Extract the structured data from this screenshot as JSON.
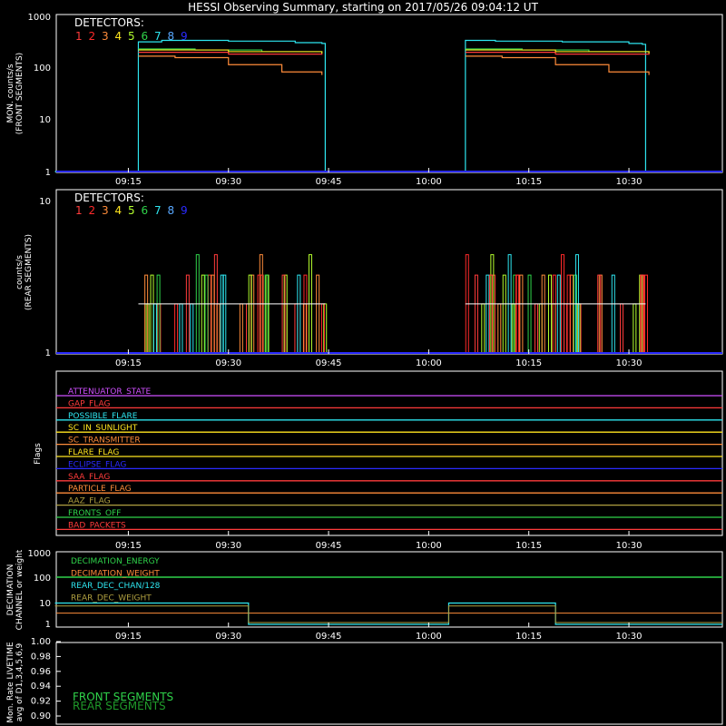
{
  "title": "HESSI Observing Summary, starting on 2017/05/26 09:04:12 UT",
  "x_tick_labels": [
    "09:15",
    "09:30",
    "09:45",
    "10:00",
    "10:15",
    "10:30"
  ],
  "detectors": {
    "label": "DETECTORS:",
    "numbers": [
      "1",
      "2",
      "3",
      "4",
      "5",
      "6",
      "7",
      "8",
      "9"
    ],
    "colors": [
      "#ff3b3b",
      "#ff2a2a",
      "#ff8c3a",
      "#ffe51f",
      "#b4ff2e",
      "#2fd34a",
      "#2ee6f0",
      "#58a8ff",
      "#2a2aff"
    ]
  },
  "chart_data": [
    {
      "type": "line",
      "panel": "front",
      "ylabel": [
        "MON. counts/s",
        "(FRONT SEGMENTS)"
      ],
      "yscale": "log",
      "ylim": [
        1,
        1000
      ],
      "y_tick_labels": [
        "1",
        "10",
        "100",
        "1000"
      ],
      "xrange": [
        "09:04:12",
        "10:44"
      ],
      "series": [
        {
          "color": "#2ee6f0",
          "x": [
            "09:04",
            "09:16",
            "09:16.5",
            "09:20",
            "09:30",
            "09:40",
            "09:44",
            "09:44.5",
            "10:05",
            "10:05.5",
            "10:10",
            "10:20",
            "10:30",
            "10:32",
            "10:32.5",
            "10:44"
          ],
          "y": [
            1,
            1,
            300,
            320,
            310,
            290,
            280,
            1,
            1,
            320,
            310,
            300,
            280,
            270,
            1,
            1
          ]
        },
        {
          "color": "#2fd34a",
          "x": [
            "09:16.5",
            "09:25",
            "09:35",
            "09:44"
          ],
          "y": [
            220,
            210,
            195,
            185
          ]
        },
        {
          "color": "#ff8c3a",
          "x": [
            "09:16.5",
            "09:22",
            "09:30",
            "09:38",
            "09:44"
          ],
          "y": [
            160,
            150,
            110,
            80,
            70
          ]
        },
        {
          "color": "#ff3b3b",
          "x": [
            "09:16.5",
            "09:30",
            "09:44"
          ],
          "y": [
            190,
            175,
            170
          ]
        },
        {
          "color": "#ffe51f",
          "x": [
            "09:16.5",
            "09:30",
            "09:44"
          ],
          "y": [
            210,
            195,
            180
          ]
        }
      ]
    },
    {
      "type": "line",
      "panel": "rear",
      "ylabel": [
        "counts/s",
        "(REAR SEGMENTS)"
      ],
      "yscale": "log",
      "ylim": [
        1,
        10
      ],
      "y_tick_labels": [
        "1",
        "10"
      ],
      "values_note": "",
      "levels": [
        1,
        2,
        3,
        4
      ]
    },
    {
      "type": "line",
      "panel": "flags",
      "ylabel": "Flags",
      "flags": [
        {
          "name": "ATTENUATOR_STATE",
          "color": "#d050ff"
        },
        {
          "name": "GAP_FLAG",
          "color": "#ff3b3b"
        },
        {
          "name": "POSSIBLE_FLARE",
          "color": "#2ee6f0"
        },
        {
          "name": "SC_IN_SUNLIGHT",
          "color": "#ffe51f"
        },
        {
          "name": "SC_TRANSMITTER",
          "color": "#ff8c3a"
        },
        {
          "name": "FLARE_FLAG",
          "color": "#ffe51f"
        },
        {
          "name": "ECLIPSE_FLAG",
          "color": "#2a2aff"
        },
        {
          "name": "SAA_FLAG",
          "color": "#ff3b3b"
        },
        {
          "name": "PARTICLE_FLAG",
          "color": "#ff8c3a"
        },
        {
          "name": "AAZ_FLAG",
          "color": "#b0a040"
        },
        {
          "name": "FRONTS_OFF",
          "color": "#2fd34a"
        },
        {
          "name": "BAD_PACKETS",
          "color": "#ff3b3b"
        }
      ]
    },
    {
      "type": "line",
      "panel": "decimation",
      "ylabel": [
        "DECIMATION",
        "CHANNEL or weight"
      ],
      "yscale": "log",
      "ylim": [
        1,
        1000
      ],
      "y_tick_labels": [
        "1",
        "10",
        "100",
        "1000"
      ],
      "series": [
        {
          "name": "DECIMATION_ENERGY",
          "color": "#2fd34a"
        },
        {
          "name": "DECIMATION_WEIGHT",
          "color": "#ff8c3a"
        },
        {
          "name": "REAR_DEC_CHAN/128",
          "color": "#2ee6f0"
        },
        {
          "name": "REAR_DEC_WEIGHT",
          "color": "#b0a040"
        }
      ]
    },
    {
      "type": "line",
      "panel": "livetime",
      "ylabel": [
        "Mon. Rate LIVETIME",
        "avg of D1,3,4,5,6,9"
      ],
      "ylim": [
        0.9,
        1.0
      ],
      "y_tick_labels": [
        "0.90",
        "0.92",
        "0.94",
        "0.96",
        "0.98",
        "1.00"
      ],
      "series": [
        {
          "name": "FRONT SEGMENTS",
          "color": "#2fd34a"
        },
        {
          "name": "REAR SEGMENTS",
          "color": "#1f9a2a"
        }
      ]
    }
  ]
}
